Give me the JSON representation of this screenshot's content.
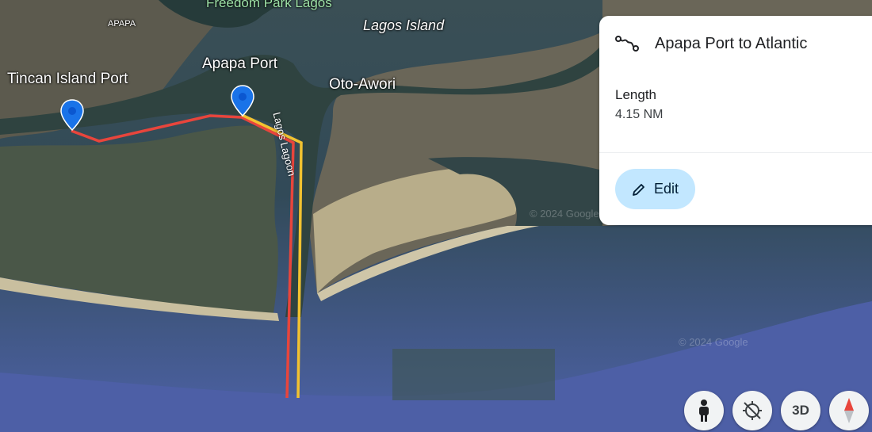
{
  "map": {
    "places": {
      "freedom_park": "Freedom Park Lagos",
      "lagos_island": "Lagos Island",
      "apapa_small": "APAPA",
      "apapa_port": "Apapa Port",
      "tincan": "Tincan Island Port",
      "oto_awori": "Oto-Awori",
      "lagos_lagoon": "Lagos Lagoon"
    },
    "copyright": "© 2024 Google",
    "route_colors": {
      "red": "#e8453c",
      "yellow": "#f2c230"
    },
    "pin_color": "#1a73e8"
  },
  "card": {
    "title": "Apapa Port to Atlantic",
    "title_icon": "route-icon",
    "length_label": "Length",
    "length_value": "4.15 NM",
    "edit_label": "Edit",
    "edit_icon": "pencil-icon"
  },
  "controls": {
    "pegman": "pegman-icon",
    "tilt": "tilt-icon",
    "three_d": "3D",
    "compass": "compass-icon"
  }
}
